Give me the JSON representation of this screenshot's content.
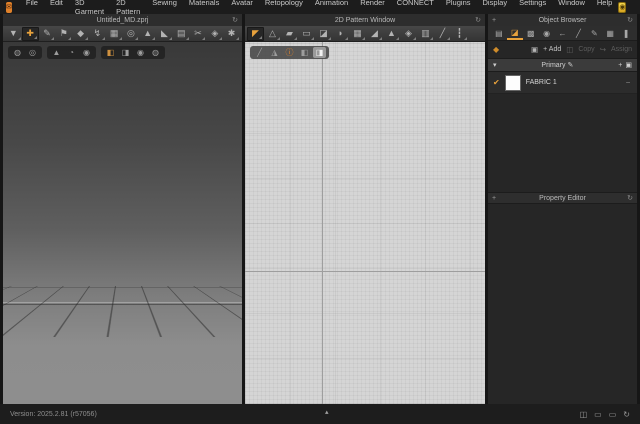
{
  "colors": {
    "accent": "#e8a23c",
    "logo_orange": "#e0812a",
    "gold_badge": "#e8c53a"
  },
  "menu_bar": {
    "logo_glyph": "✉",
    "items": [
      "File",
      "Edit",
      "3D Garment",
      "2D Pattern",
      "Sewing",
      "Materials",
      "Avatar",
      "Retopology",
      "Animation",
      "Render",
      "CONNECT",
      "Plugins",
      "Display",
      "Settings",
      "Window",
      "Help"
    ],
    "badge_glyph": "◉",
    "window_controls": {
      "minimize": "–",
      "restore": "◱",
      "close": "×"
    }
  },
  "panel_3d": {
    "title": "Untitled_MD.zprj",
    "refresh_icon": "↻",
    "toolbar": [
      {
        "name": "simulate-dropdown-icon",
        "glyph": "▼"
      },
      {
        "name": "select-move-tool-icon",
        "glyph": "✚",
        "active": true
      },
      {
        "name": "pen-tool-icon",
        "glyph": "✎"
      },
      {
        "name": "brush-tool-icon",
        "glyph": "⚑"
      },
      {
        "name": "pin-tool-icon",
        "glyph": "◆"
      },
      {
        "name": "tack-tool-icon",
        "glyph": "↯"
      },
      {
        "name": "arrangement-tool-icon",
        "glyph": "▦"
      },
      {
        "name": "gizmo-tool-icon",
        "glyph": "◎"
      },
      {
        "name": "avatar-tool-icon",
        "glyph": "▲"
      },
      {
        "name": "drape-tool-icon",
        "glyph": "◣"
      },
      {
        "name": "grid-tool-icon",
        "glyph": "▤"
      },
      {
        "name": "scissors-tool-icon",
        "glyph": "✂"
      },
      {
        "name": "bell-tool-icon",
        "glyph": "◈"
      },
      {
        "name": "settings-tool-icon",
        "glyph": "✱"
      }
    ],
    "overlay_group_1": [
      {
        "name": "show-3d-garment-icon",
        "glyph": "◍"
      },
      {
        "name": "show-highlight-icon",
        "glyph": "◎"
      }
    ],
    "overlay_group_2": [
      {
        "name": "show-garment-icon",
        "glyph": "▲"
      },
      {
        "name": "show-pins-icon",
        "glyph": "◔"
      },
      {
        "name": "show-avatar-icon",
        "glyph": "◉"
      }
    ],
    "overlay_group_3": [
      {
        "name": "textured-surface-icon",
        "glyph": "◧",
        "cls": "accent"
      },
      {
        "name": "mesh-surface-icon",
        "glyph": "◨"
      },
      {
        "name": "avatar-surface-icon",
        "glyph": "◉"
      },
      {
        "name": "wireframe-icon",
        "glyph": "◍"
      }
    ]
  },
  "panel_2d": {
    "title": "2D Pattern Window",
    "refresh_icon": "↻",
    "toolbar": [
      {
        "name": "transform-pattern-icon",
        "glyph": "◤",
        "active": true
      },
      {
        "name": "edit-pattern-icon",
        "glyph": "△"
      },
      {
        "name": "polygon-pattern-icon",
        "glyph": "▰"
      },
      {
        "name": "rectangle-pattern-icon",
        "glyph": "▭"
      },
      {
        "name": "texture-editor-icon",
        "glyph": "◪"
      },
      {
        "name": "trace-pattern-icon",
        "glyph": "◗"
      },
      {
        "name": "internal-polygon-icon",
        "glyph": "▦"
      },
      {
        "name": "steam-iron-icon",
        "glyph": "◢"
      },
      {
        "name": "flatten-garment-icon",
        "glyph": "▲"
      },
      {
        "name": "notch-tool-icon",
        "glyph": "◈"
      },
      {
        "name": "pleats-tool-icon",
        "glyph": "▥"
      },
      {
        "name": "seam-taping-icon",
        "glyph": "╱"
      },
      {
        "name": "zipper-tool-icon",
        "glyph": "┇"
      }
    ],
    "overlay": [
      {
        "name": "pen-overlay-icon",
        "glyph": "╱"
      },
      {
        "name": "garment-overlay-icon",
        "glyph": "◮"
      },
      {
        "name": "info-overlay-icon",
        "glyph": "ⓘ",
        "cls": "info"
      },
      {
        "name": "fabric-overlay-icon",
        "glyph": "◧"
      },
      {
        "name": "white-garment-overlay-icon",
        "glyph": "◨",
        "cls": "selected"
      }
    ]
  },
  "object_browser": {
    "expand_icon": "+",
    "title": "Object Browser",
    "refresh_icon": "↻",
    "tabs": [
      {
        "name": "tab-scene-icon",
        "glyph": "▤"
      },
      {
        "name": "tab-fabric-icon",
        "glyph": "◪",
        "active": true
      },
      {
        "name": "tab-graphic-icon",
        "glyph": "▩"
      },
      {
        "name": "tab-button-icon",
        "glyph": "◉"
      },
      {
        "name": "tab-buttonhole-icon",
        "glyph": "←"
      },
      {
        "name": "tab-topstitch-icon",
        "glyph": "╱"
      },
      {
        "name": "tab-stitch-icon",
        "glyph": "✎"
      },
      {
        "name": "tab-puckering-icon",
        "glyph": "▦"
      },
      {
        "name": "tab-zipper-icon",
        "glyph": "❚"
      }
    ],
    "category_icon": "◆",
    "actions": {
      "folder_icon": "▣",
      "add": "+ Add",
      "copy_icon": "◫",
      "copy": "Copy",
      "assign_icon": "↪",
      "assign": "Assign"
    },
    "section": {
      "collapse_icon": "▾",
      "name": "Primary",
      "edit_icon": "✎",
      "add_icon": "+",
      "folder_icon": "▣"
    },
    "rows": [
      {
        "check": "✔",
        "label": "FABRIC 1",
        "remove": "–"
      }
    ]
  },
  "property_editor": {
    "expand_icon": "+",
    "title": "Property Editor",
    "refresh_icon": "↻"
  },
  "status_bar": {
    "version": "Version: 2025.2.81 (r57056)",
    "expand_icon": "▴",
    "right_icons": [
      {
        "name": "layout-columns-icon",
        "glyph": "◫"
      },
      {
        "name": "monitor-primary-icon",
        "glyph": "▭"
      },
      {
        "name": "monitor-secondary-icon",
        "glyph": "▭"
      },
      {
        "name": "sync-icon",
        "glyph": "↻"
      }
    ]
  }
}
